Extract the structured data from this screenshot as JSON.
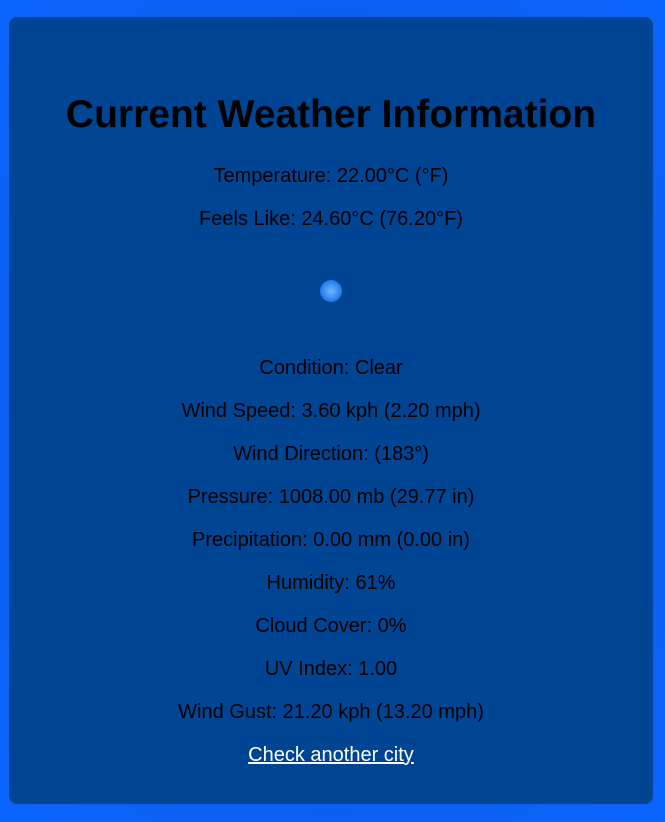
{
  "title": "Current Weather Information",
  "temperature": "Temperature: 22.00°C (°F)",
  "feels_like": "Feels Like: 24.60°C (76.20°F)",
  "condition_icon": "clear-night-moon-icon",
  "condition": "Condition: Clear",
  "wind_speed": "Wind Speed: 3.60 kph (2.20 mph)",
  "wind_direction": "Wind Direction: (183°)",
  "pressure": "Pressure: 1008.00 mb (29.77 in)",
  "precipitation": "Precipitation: 0.00 mm (0.00 in)",
  "humidity": "Humidity: 61%",
  "cloud_cover": "Cloud Cover: 0%",
  "uv_index": "UV Index: 1.00",
  "wind_gust": "Wind Gust: 21.20 kph (13.20 mph)",
  "check_link": "Check another city",
  "colors": {
    "page_background": "#0a5cf5",
    "card_background": "#004494",
    "text": "#000000",
    "link": "#ffffff"
  }
}
